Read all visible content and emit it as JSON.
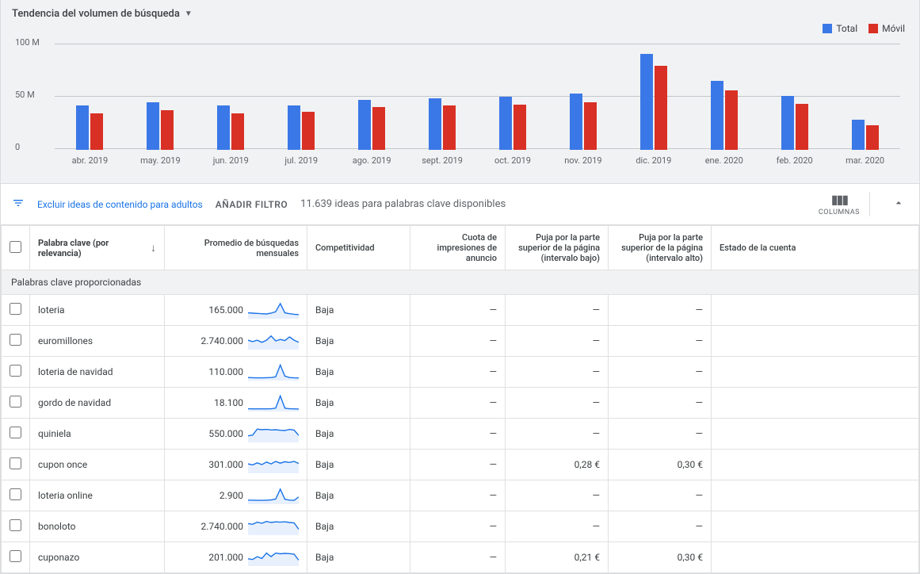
{
  "chart": {
    "title": "Tendencia del volumen de búsqueda",
    "legend_total": "Total",
    "legend_movil": "Móvil",
    "yticks": [
      "0",
      "50 M",
      "100 M"
    ]
  },
  "chart_data": {
    "type": "bar",
    "title": "Tendencia del volumen de búsqueda",
    "xlabel": "",
    "ylabel": "",
    "ylim": [
      0,
      100
    ],
    "categories": [
      "abr. 2019",
      "may. 2019",
      "jun. 2019",
      "jul. 2019",
      "ago. 2019",
      "sept. 2019",
      "oct. 2019",
      "nov. 2019",
      "dic. 2019",
      "ene. 2020",
      "feb. 2020",
      "mar. 2020"
    ],
    "series": [
      {
        "name": "Total",
        "values": [
          41,
          44,
          41,
          41,
          46,
          48,
          49,
          52,
          89,
          64,
          50,
          28
        ]
      },
      {
        "name": "Móvil",
        "values": [
          34,
          37,
          34,
          35,
          40,
          41,
          42,
          44,
          78,
          55,
          43,
          23
        ]
      }
    ]
  },
  "filters": {
    "exclude_adult": "Excluir ideas de contenido para adultos",
    "add_filter": "AÑADIR FILTRO",
    "ideas_available": "11.639 ideas para palabras clave disponibles",
    "columns": "COLUMNAS"
  },
  "table": {
    "headers": {
      "keyword": "Palabra clave (por relevancia)",
      "avg_searches": "Promedio de búsquedas mensuales",
      "competition": "Competitividad",
      "impression_share": "Cuota de impresiones de anuncio",
      "bid_low": "Puja por la parte superior de la página (intervalo bajo)",
      "bid_high": "Puja por la parte superior de la página (intervalo alto)",
      "account_status": "Estado de la cuenta"
    },
    "group_label": "Palabras clave proporcionadas",
    "rows": [
      {
        "keyword": "loteria",
        "avg": "165.000",
        "competition": "Baja",
        "imp": "—",
        "bid_low": "—",
        "bid_high": "—",
        "spark": [
          0.3,
          0.28,
          0.26,
          0.24,
          0.22,
          0.28,
          0.38,
          0.95,
          0.3,
          0.24,
          0.2,
          0.18
        ]
      },
      {
        "keyword": "euromillones",
        "avg": "2.740.000",
        "competition": "Baja",
        "imp": "—",
        "bid_low": "—",
        "bid_high": "—",
        "spark": [
          0.55,
          0.45,
          0.55,
          0.4,
          0.55,
          0.85,
          0.5,
          0.6,
          0.52,
          0.78,
          0.55,
          0.4
        ]
      },
      {
        "keyword": "loteria de navidad",
        "avg": "110.000",
        "competition": "Baja",
        "imp": "—",
        "bid_low": "—",
        "bid_high": "—",
        "spark": [
          0.1,
          0.09,
          0.08,
          0.08,
          0.09,
          0.1,
          0.15,
          0.98,
          0.2,
          0.1,
          0.08,
          0.07
        ]
      },
      {
        "keyword": "gordo de navidad",
        "avg": "18.100",
        "competition": "Baja",
        "imp": "—",
        "bid_low": "—",
        "bid_high": "—",
        "spark": [
          0.08,
          0.07,
          0.07,
          0.07,
          0.07,
          0.08,
          0.12,
          0.98,
          0.12,
          0.08,
          0.07,
          0.06
        ]
      },
      {
        "keyword": "quiniela",
        "avg": "550.000",
        "competition": "Baja",
        "imp": "—",
        "bid_low": "—",
        "bid_high": "—",
        "spark": [
          0.35,
          0.4,
          0.82,
          0.78,
          0.8,
          0.76,
          0.78,
          0.74,
          0.72,
          0.8,
          0.75,
          0.38
        ]
      },
      {
        "keyword": "cupon once",
        "avg": "301.000",
        "competition": "Baja",
        "imp": "—",
        "bid_low": "0,28 €",
        "bid_high": "0,30 €",
        "spark": [
          0.55,
          0.48,
          0.62,
          0.5,
          0.68,
          0.55,
          0.72,
          0.6,
          0.7,
          0.65,
          0.72,
          0.58
        ]
      },
      {
        "keyword": "loteria online",
        "avg": "2.900",
        "competition": "Baja",
        "imp": "—",
        "bid_low": "—",
        "bid_high": "—",
        "spark": [
          0.18,
          0.17,
          0.16,
          0.16,
          0.17,
          0.19,
          0.25,
          0.95,
          0.24,
          0.18,
          0.16,
          0.4
        ]
      },
      {
        "keyword": "bonoloto",
        "avg": "2.740.000",
        "competition": "Baja",
        "imp": "—",
        "bid_low": "—",
        "bid_high": "—",
        "spark": [
          0.7,
          0.65,
          0.8,
          0.72,
          0.85,
          0.78,
          0.82,
          0.8,
          0.82,
          0.78,
          0.75,
          0.3
        ]
      },
      {
        "keyword": "cuponazo",
        "avg": "201.000",
        "competition": "Baja",
        "imp": "—",
        "bid_low": "0,21 €",
        "bid_high": "0,30 €",
        "spark": [
          0.4,
          0.35,
          0.55,
          0.42,
          0.8,
          0.55,
          0.8,
          0.75,
          0.78,
          0.76,
          0.72,
          0.3
        ]
      }
    ]
  }
}
